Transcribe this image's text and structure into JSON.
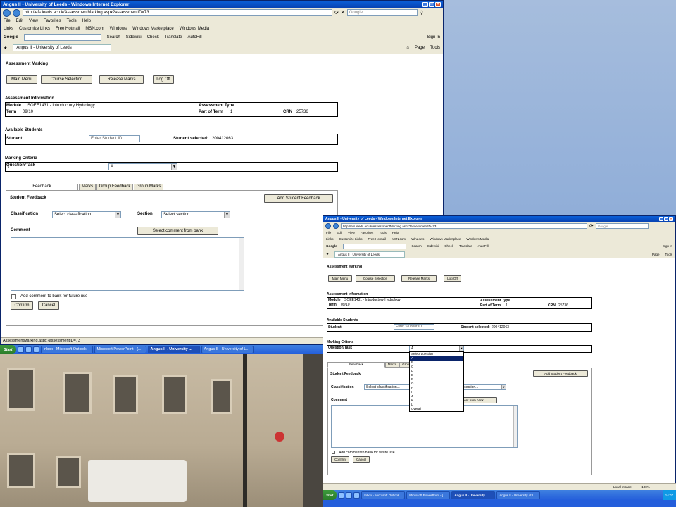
{
  "browser": {
    "title": "Angus II - University of Leeds - Windows Internet Explorer",
    "url": "http://efs.leeds.ac.uk/AssessmentMarking.aspx?assessmentID=73",
    "search_placeholder": "Google",
    "menu": [
      "File",
      "Edit",
      "View",
      "Favorites",
      "Tools",
      "Help"
    ],
    "links_label": "Links",
    "links": [
      "Customize Links",
      "Free Hotmail",
      "MSN.com",
      "Windows",
      "Windows Marketplace",
      "Windows Media"
    ],
    "google_label": "Google",
    "toolbar_items": [
      "Search",
      "Sidewiki",
      "Check",
      "Translate",
      "AutoFill",
      "Sign In"
    ],
    "tab_title": "Angus II - University of Leeds",
    "cmd_items": [
      "Page",
      "Tools"
    ],
    "status_url": "AssessmentMarking.aspx?assessmentID=73",
    "zone": "Local intranet",
    "zoom": "100%"
  },
  "page": {
    "heading": "Assessment Marking",
    "buttons": {
      "main_menu": "Main Menu",
      "course_selection": "Course Selection",
      "release_marks": "Release Marks",
      "log_off": "Log Off"
    },
    "info_heading": "Assessment Information",
    "module_label": "Module",
    "module_value": "SOEE1431 - Introductory Hydrology",
    "term_label": "Term",
    "term_value": "09/10",
    "assessment_type_label": "Assessment Type",
    "part_of_term_label": "Part of Term",
    "part_of_term_value": "1",
    "crn_label": "CRN",
    "crn_value": "25736",
    "students_heading": "Available Students",
    "student_label": "Student",
    "student_placeholder": "Enter Student ID...",
    "student_selected_label": "Student selected:",
    "student_selected_value": "200412063",
    "criteria_heading": "Marking Criteria",
    "question_label": "Question/Task",
    "question_value": "A",
    "tabs": [
      "Feedback",
      "Marks",
      "Group Feedback",
      "Group Marks"
    ],
    "feedback_heading": "Student Feedback",
    "add_feedback_button": "Add Student Feedback",
    "classification_label": "Classification",
    "classification_value": "Select classification...",
    "section_label": "Section",
    "section_value": "Select section...",
    "comment_label": "Comment",
    "comment_bank_button": "Select comment from bank",
    "checkbox_label": "Add comment to bank for future use",
    "confirm_button": "Confirm",
    "cancel_button": "Cancel"
  },
  "dropdown": {
    "options": [
      "Select question",
      "A",
      "B",
      "C",
      "D",
      "E",
      "F",
      "G",
      "H",
      "I",
      "J",
      "K",
      "L",
      "Overall"
    ],
    "selected": "A"
  },
  "taskbar": {
    "start": "Start",
    "items": [
      "Inbox - Microsoft Outlook",
      "Microsoft PowerPoint - [...",
      "Angus II - University ...",
      "Angus II - University of L..."
    ],
    "clock": "14:07"
  }
}
